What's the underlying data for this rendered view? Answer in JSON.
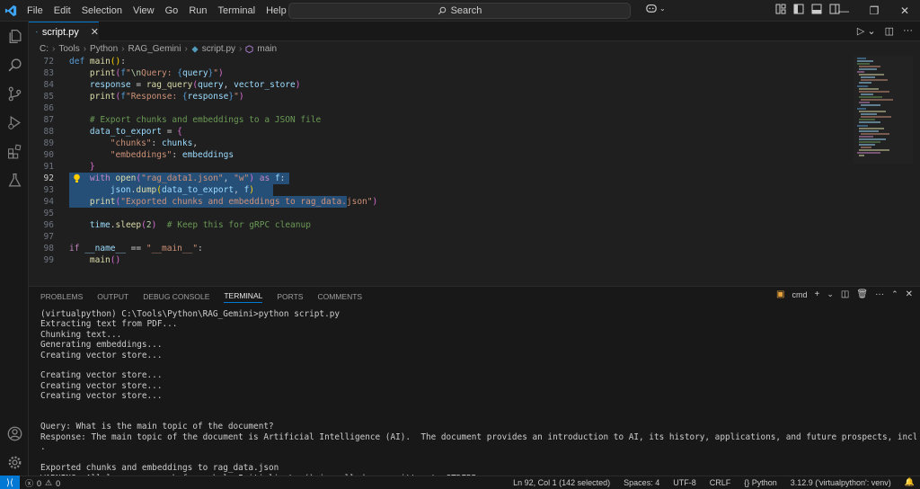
{
  "menu": [
    "File",
    "Edit",
    "Selection",
    "View",
    "Go",
    "Run",
    "Terminal",
    "Help"
  ],
  "search": {
    "label": "Search"
  },
  "tab": {
    "label": "script.py"
  },
  "breadcrumb": [
    "C:",
    "Tools",
    "Python",
    "RAG_Gemini",
    "script.py",
    "main"
  ],
  "editor": {
    "lines": [
      {
        "n": "72",
        "text": "def main():"
      },
      {
        "n": "83",
        "text": "    print(f\"\\nQuery: {query}\")"
      },
      {
        "n": "84",
        "text": "    response = rag_query(query, vector_store)"
      },
      {
        "n": "85",
        "text": "    print(f\"Response: {response}\")"
      },
      {
        "n": "86",
        "text": ""
      },
      {
        "n": "87",
        "text": "    # Export chunks and embeddings to a JSON file"
      },
      {
        "n": "88",
        "text": "    data_to_export = {"
      },
      {
        "n": "89",
        "text": "        \"chunks\": chunks,"
      },
      {
        "n": "90",
        "text": "        \"embeddings\": embeddings"
      },
      {
        "n": "91",
        "text": "    }"
      },
      {
        "n": "92",
        "text": "    with open(\"rag_data1.json\", \"w\") as f:"
      },
      {
        "n": "93",
        "text": "        json.dump(data_to_export, f)"
      },
      {
        "n": "94",
        "text": "    print(\"Exported chunks and embeddings to rag_data.json\")"
      },
      {
        "n": "95",
        "text": ""
      },
      {
        "n": "96",
        "text": "    time.sleep(2)  # Keep this for gRPC cleanup"
      },
      {
        "n": "97",
        "text": ""
      },
      {
        "n": "98",
        "text": "if __name__ == \"__main__\":"
      },
      {
        "n": "99",
        "text": "    main()"
      }
    ]
  },
  "panel": {
    "tabs": [
      "PROBLEMS",
      "OUTPUT",
      "DEBUG CONSOLE",
      "TERMINAL",
      "PORTS",
      "COMMENTS"
    ],
    "active_tab": "TERMINAL",
    "shell_label": "cmd"
  },
  "terminal": {
    "text": "(virtualpython) C:\\Tools\\Python\\RAG_Gemini>python script.py\nExtracting text from PDF...\nChunking text...\nGenerating embeddings...\nCreating vector store...\n\nCreating vector store...\nCreating vector store...\nCreating vector store...\n\n\nQuery: What is the main topic of the document?\nResponse: The main topic of the document is Artificial Intelligence (AI).  The document provides an introduction to AI, its history, applications, and future prospects, including ethical considerations\n.\n\nExported chunks and embeddings to rag_data.json\nWARNING: All log messages before absl::InitializeLog() is called are written to STDERR"
  },
  "status": {
    "errors": "0",
    "warnings": "0",
    "position": "Ln 92, Col 1 (142 selected)",
    "spaces": "Spaces: 4",
    "encoding": "UTF-8",
    "eol": "CRLF",
    "language": "Python",
    "interpreter": "3.12.9 ('virtualpython': venv)"
  },
  "colors": {
    "accent": "#0078d4",
    "selection": "#264f78",
    "background": "#1f1f1f"
  }
}
